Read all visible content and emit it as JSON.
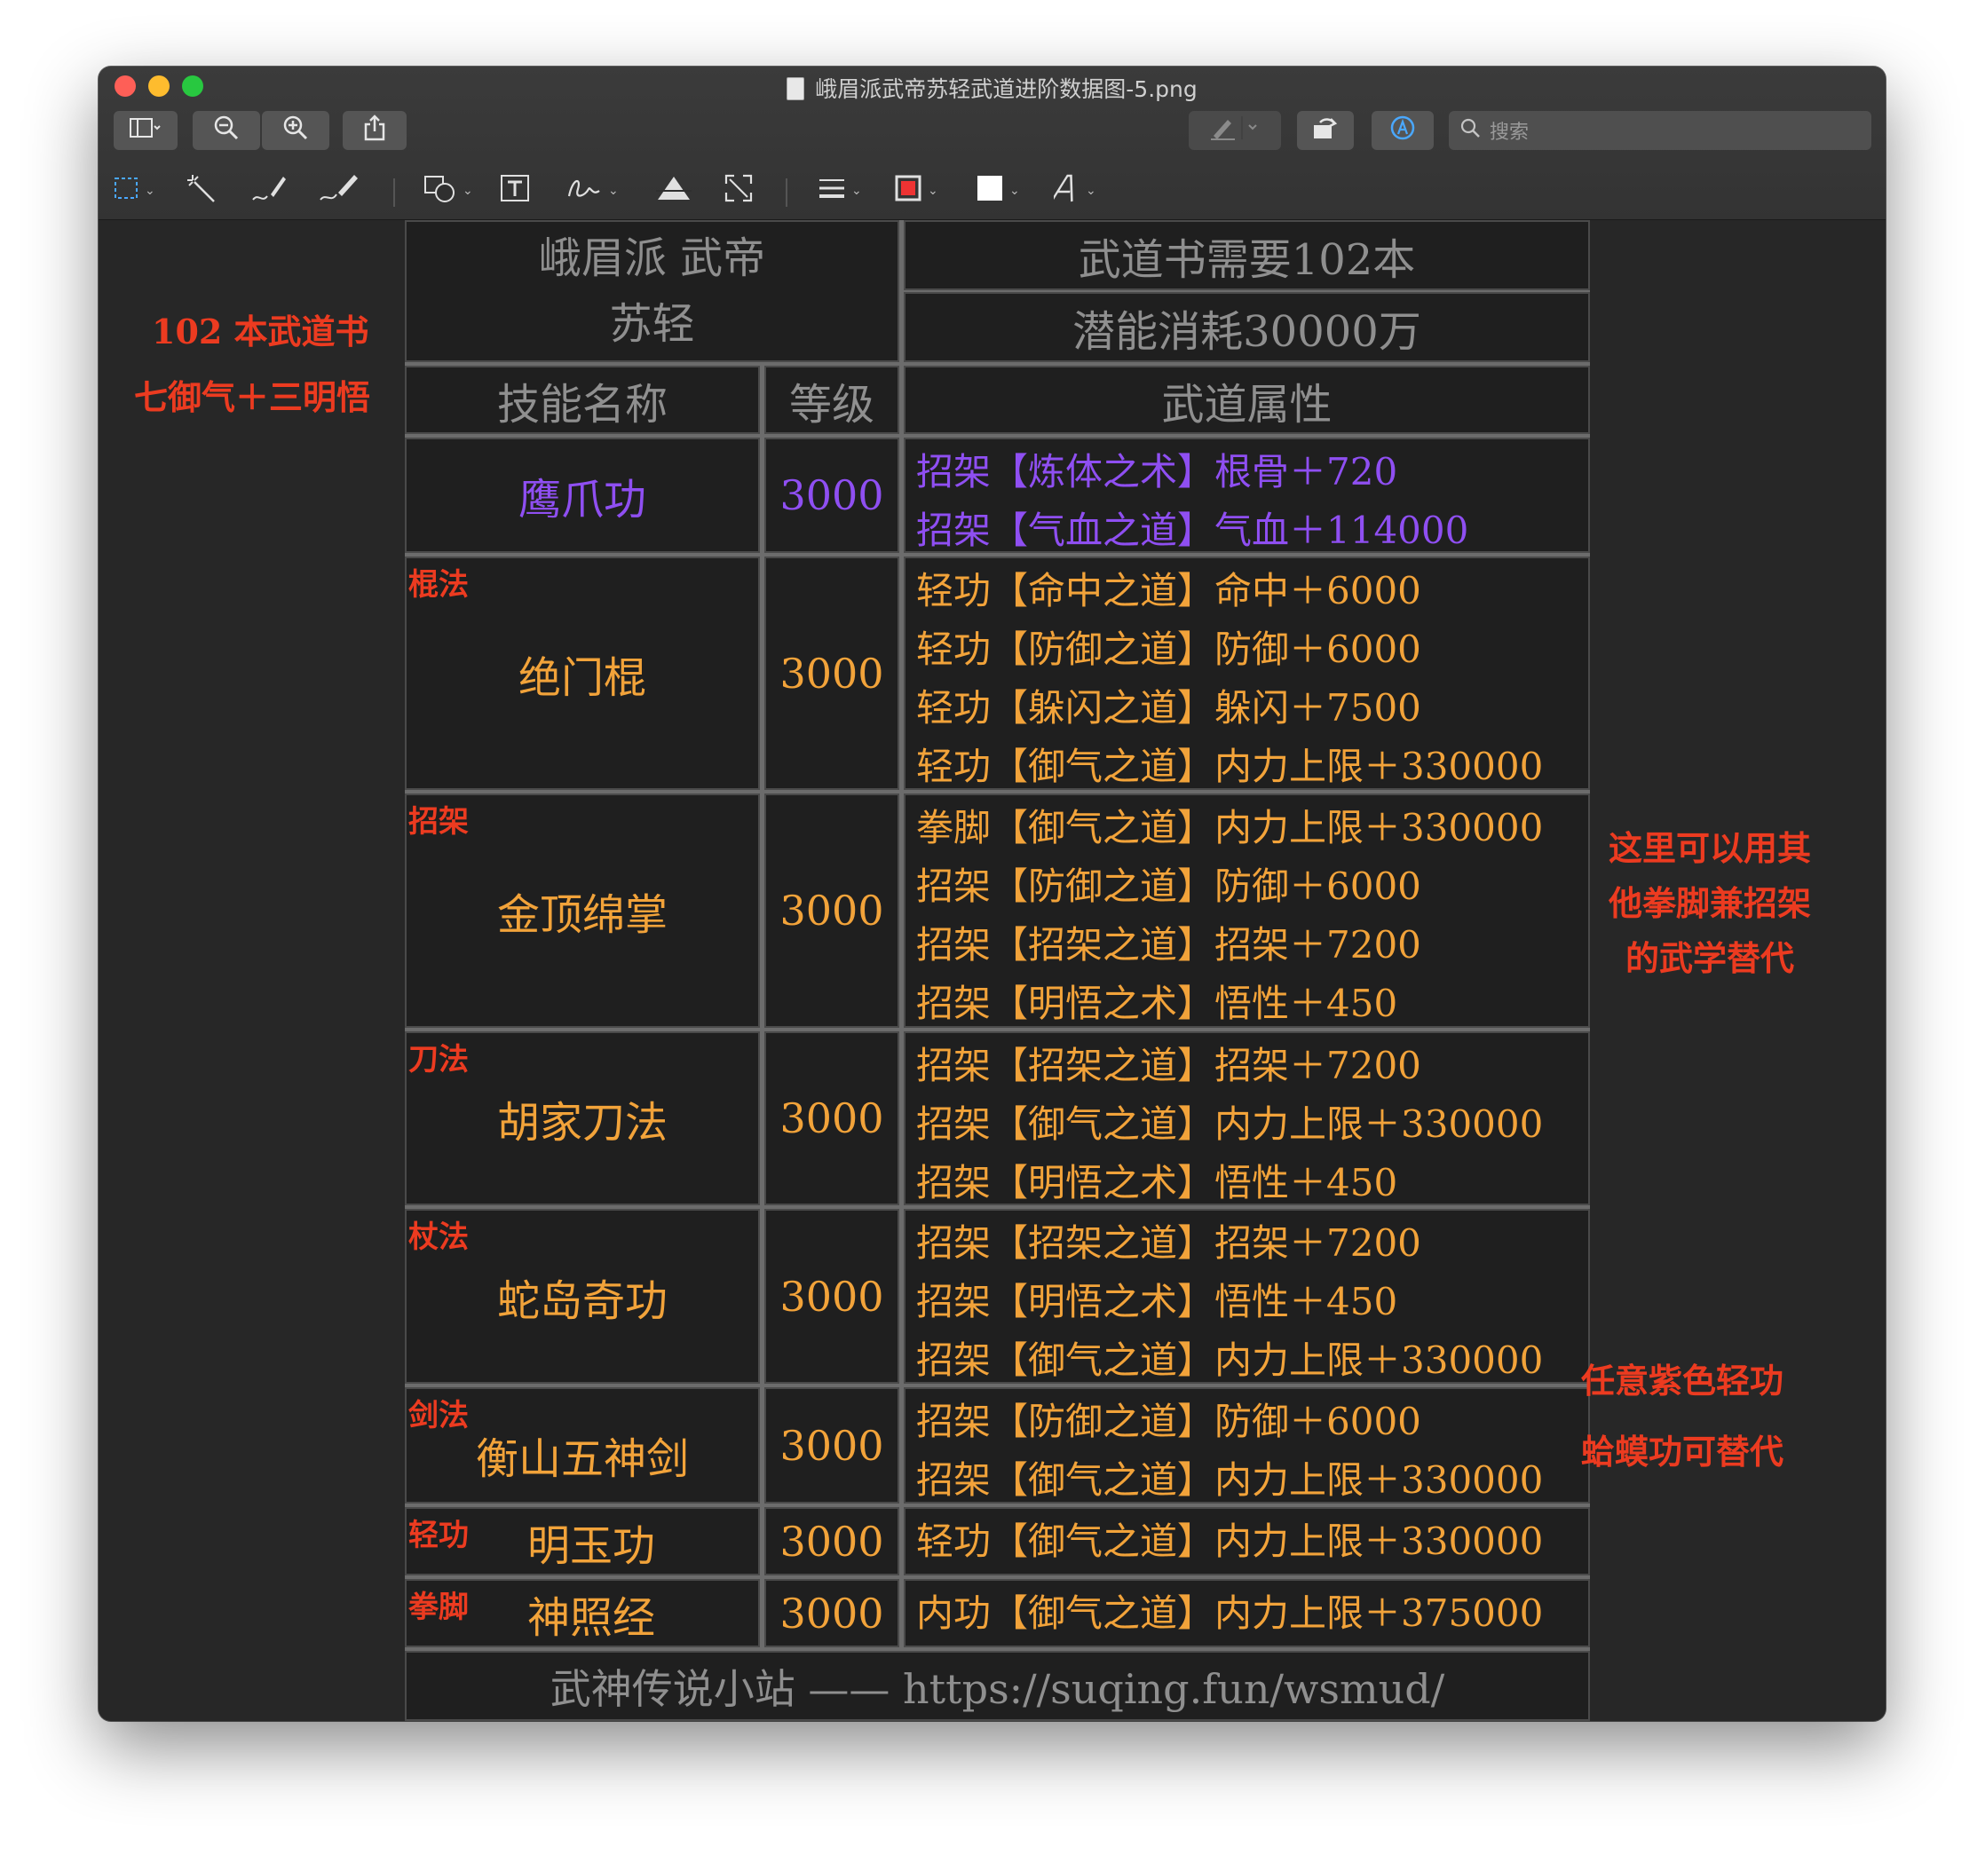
{
  "window": {
    "title": "峨眉派武帝苏轻武道进阶数据图-5.png",
    "search_placeholder": "搜索"
  },
  "toolbar": {
    "sidebar_icon": "sidebar-icon",
    "zoom_out_icon": "zoom-out-icon",
    "zoom_in_icon": "zoom-in-icon",
    "share_icon": "share-icon",
    "markup_pen_icon": "pen-icon",
    "rotate_icon": "rotate-icon",
    "annotate_icon": "annotate-icon"
  },
  "header": {
    "school_line1": "峨眉派 武帝",
    "school_line2": "苏轻",
    "books_needed": "武道书需要102本",
    "potential_cost": "潜能消耗30000万",
    "col_skill": "技能名称",
    "col_level": "等级",
    "col_attr": "武道属性"
  },
  "rows": [
    {
      "tag": "",
      "name": "鹰爪功",
      "level": "3000",
      "color": "#8f4ff2",
      "attrs": [
        "招架【炼体之术】根骨＋720",
        "招架【气血之道】气血＋114000"
      ]
    },
    {
      "tag": "棍法",
      "name": "绝门棍",
      "level": "3000",
      "color": "#f2a33a",
      "attrs": [
        "轻功【命中之道】命中＋6000",
        "轻功【防御之道】防御＋6000",
        "轻功【躲闪之道】躲闪＋7500",
        "轻功【御气之道】内力上限＋330000"
      ]
    },
    {
      "tag": "招架",
      "name": "金顶绵掌",
      "level": "3000",
      "color": "#f2a33a",
      "attrs": [
        "拳脚【御气之道】内力上限＋330000",
        "招架【防御之道】防御＋6000",
        "招架【招架之道】招架＋7200",
        "招架【明悟之术】悟性＋450"
      ]
    },
    {
      "tag": "刀法",
      "name": "胡家刀法",
      "level": "3000",
      "color": "#f2a33a",
      "attrs": [
        "招架【招架之道】招架＋7200",
        "招架【御气之道】内力上限＋330000",
        "招架【明悟之术】悟性＋450"
      ]
    },
    {
      "tag": "杖法",
      "name": "蛇岛奇功",
      "level": "3000",
      "color": "#f2a33a",
      "attrs": [
        "招架【招架之道】招架＋7200",
        "招架【明悟之术】悟性＋450",
        "招架【御气之道】内力上限＋330000"
      ]
    },
    {
      "tag": "剑法",
      "name": "衡山五神剑",
      "level": "3000",
      "color": "#f2a33a",
      "attrs": [
        "招架【防御之道】防御＋6000",
        "招架【御气之道】内力上限＋330000"
      ]
    },
    {
      "tag": "轻功",
      "name": "明玉功",
      "level": "3000",
      "color": "#f2a33a",
      "attrs": [
        "轻功【御气之道】内力上限＋330000"
      ]
    },
    {
      "tag": "拳脚",
      "name": "神照经",
      "level": "3000",
      "color": "#f2a33a",
      "attrs": [
        "内功【御气之道】内力上限＋375000"
      ]
    }
  ],
  "footer": "武神传说小站 —— https://suqing.fun/wsmud/",
  "notes": {
    "left_line1": "102  本武道书",
    "left_line2": "七御气＋三明悟",
    "right_a_line1": "这里可以用其",
    "right_a_line2": "他拳脚兼招架",
    "right_a_line3": "的武学替代",
    "right_b_line1": "任意紫色轻功",
    "right_b_line2": "蛤蟆功可替代"
  }
}
